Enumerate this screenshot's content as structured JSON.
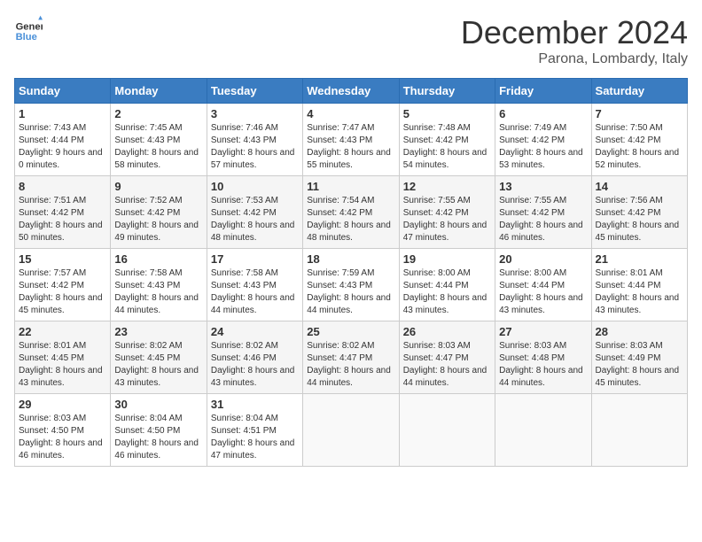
{
  "header": {
    "logo_line1": "General",
    "logo_line2": "Blue",
    "title": "December 2024",
    "subtitle": "Parona, Lombardy, Italy"
  },
  "weekdays": [
    "Sunday",
    "Monday",
    "Tuesday",
    "Wednesday",
    "Thursday",
    "Friday",
    "Saturday"
  ],
  "weeks": [
    [
      {
        "day": "1",
        "sunrise": "7:43 AM",
        "sunset": "4:44 PM",
        "daylight": "9 hours and 0 minutes."
      },
      {
        "day": "2",
        "sunrise": "7:45 AM",
        "sunset": "4:43 PM",
        "daylight": "8 hours and 58 minutes."
      },
      {
        "day": "3",
        "sunrise": "7:46 AM",
        "sunset": "4:43 PM",
        "daylight": "8 hours and 57 minutes."
      },
      {
        "day": "4",
        "sunrise": "7:47 AM",
        "sunset": "4:43 PM",
        "daylight": "8 hours and 55 minutes."
      },
      {
        "day": "5",
        "sunrise": "7:48 AM",
        "sunset": "4:42 PM",
        "daylight": "8 hours and 54 minutes."
      },
      {
        "day": "6",
        "sunrise": "7:49 AM",
        "sunset": "4:42 PM",
        "daylight": "8 hours and 53 minutes."
      },
      {
        "day": "7",
        "sunrise": "7:50 AM",
        "sunset": "4:42 PM",
        "daylight": "8 hours and 52 minutes."
      }
    ],
    [
      {
        "day": "8",
        "sunrise": "7:51 AM",
        "sunset": "4:42 PM",
        "daylight": "8 hours and 50 minutes."
      },
      {
        "day": "9",
        "sunrise": "7:52 AM",
        "sunset": "4:42 PM",
        "daylight": "8 hours and 49 minutes."
      },
      {
        "day": "10",
        "sunrise": "7:53 AM",
        "sunset": "4:42 PM",
        "daylight": "8 hours and 48 minutes."
      },
      {
        "day": "11",
        "sunrise": "7:54 AM",
        "sunset": "4:42 PM",
        "daylight": "8 hours and 48 minutes."
      },
      {
        "day": "12",
        "sunrise": "7:55 AM",
        "sunset": "4:42 PM",
        "daylight": "8 hours and 47 minutes."
      },
      {
        "day": "13",
        "sunrise": "7:55 AM",
        "sunset": "4:42 PM",
        "daylight": "8 hours and 46 minutes."
      },
      {
        "day": "14",
        "sunrise": "7:56 AM",
        "sunset": "4:42 PM",
        "daylight": "8 hours and 45 minutes."
      }
    ],
    [
      {
        "day": "15",
        "sunrise": "7:57 AM",
        "sunset": "4:42 PM",
        "daylight": "8 hours and 45 minutes."
      },
      {
        "day": "16",
        "sunrise": "7:58 AM",
        "sunset": "4:43 PM",
        "daylight": "8 hours and 44 minutes."
      },
      {
        "day": "17",
        "sunrise": "7:58 AM",
        "sunset": "4:43 PM",
        "daylight": "8 hours and 44 minutes."
      },
      {
        "day": "18",
        "sunrise": "7:59 AM",
        "sunset": "4:43 PM",
        "daylight": "8 hours and 44 minutes."
      },
      {
        "day": "19",
        "sunrise": "8:00 AM",
        "sunset": "4:44 PM",
        "daylight": "8 hours and 43 minutes."
      },
      {
        "day": "20",
        "sunrise": "8:00 AM",
        "sunset": "4:44 PM",
        "daylight": "8 hours and 43 minutes."
      },
      {
        "day": "21",
        "sunrise": "8:01 AM",
        "sunset": "4:44 PM",
        "daylight": "8 hours and 43 minutes."
      }
    ],
    [
      {
        "day": "22",
        "sunrise": "8:01 AM",
        "sunset": "4:45 PM",
        "daylight": "8 hours and 43 minutes."
      },
      {
        "day": "23",
        "sunrise": "8:02 AM",
        "sunset": "4:45 PM",
        "daylight": "8 hours and 43 minutes."
      },
      {
        "day": "24",
        "sunrise": "8:02 AM",
        "sunset": "4:46 PM",
        "daylight": "8 hours and 43 minutes."
      },
      {
        "day": "25",
        "sunrise": "8:02 AM",
        "sunset": "4:47 PM",
        "daylight": "8 hours and 44 minutes."
      },
      {
        "day": "26",
        "sunrise": "8:03 AM",
        "sunset": "4:47 PM",
        "daylight": "8 hours and 44 minutes."
      },
      {
        "day": "27",
        "sunrise": "8:03 AM",
        "sunset": "4:48 PM",
        "daylight": "8 hours and 44 minutes."
      },
      {
        "day": "28",
        "sunrise": "8:03 AM",
        "sunset": "4:49 PM",
        "daylight": "8 hours and 45 minutes."
      }
    ],
    [
      {
        "day": "29",
        "sunrise": "8:03 AM",
        "sunset": "4:50 PM",
        "daylight": "8 hours and 46 minutes."
      },
      {
        "day": "30",
        "sunrise": "8:04 AM",
        "sunset": "4:50 PM",
        "daylight": "8 hours and 46 minutes."
      },
      {
        "day": "31",
        "sunrise": "8:04 AM",
        "sunset": "4:51 PM",
        "daylight": "8 hours and 47 minutes."
      },
      null,
      null,
      null,
      null
    ]
  ]
}
